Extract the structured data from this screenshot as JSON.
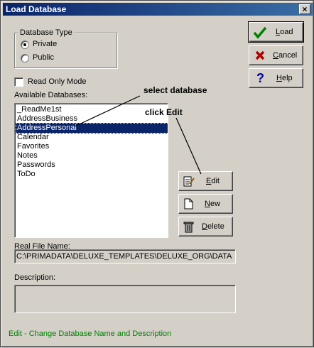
{
  "window": {
    "title": "Load Database",
    "close": "×"
  },
  "db_type": {
    "legend": "Database Type",
    "options": [
      {
        "label": "Private",
        "selected": true
      },
      {
        "label": "Public",
        "selected": false
      }
    ]
  },
  "read_only": {
    "label": "Read Only Mode",
    "checked": false
  },
  "available": {
    "label": "Available Databases:",
    "items": [
      "_ReadMe1st",
      "AddressBusiness",
      "AddressPersonal",
      "Calendar",
      "Favorites",
      "Notes",
      "Passwords",
      "ToDo"
    ],
    "selected_index": 2
  },
  "real_file": {
    "label": "Real File Name:",
    "value": "C:\\PRIMADATA\\DELUXE_TEMPLATES\\DELUXE_ORG\\DATA"
  },
  "description": {
    "label": "Description:",
    "value": ""
  },
  "buttons": {
    "load": {
      "first": "L",
      "rest": "oad"
    },
    "cancel": {
      "first": "C",
      "rest": "ancel"
    },
    "help": {
      "first": "H",
      "rest": "elp"
    },
    "edit": {
      "first": "E",
      "rest": "dit"
    },
    "new": {
      "first": "N",
      "rest": "ew"
    },
    "delete": {
      "first": "D",
      "rest": "elete"
    }
  },
  "annotations": {
    "select": "select database",
    "edit": "click Edit"
  },
  "status": "Edit - Change Database Name and Description",
  "colors": {
    "titlebar": "#0a246a",
    "selection": "#0a246a",
    "status": "#008000",
    "cancel_icon": "#b00000",
    "check_icon": "#008000"
  }
}
